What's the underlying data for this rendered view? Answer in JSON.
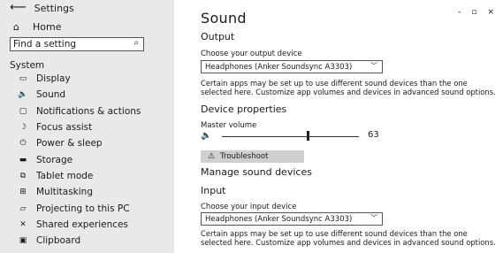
{
  "window": {
    "title": "Settings",
    "minimize": "-",
    "maximize": "▫",
    "close": "×"
  },
  "sidebar": {
    "home_label": "Home",
    "search_placeholder": "Find a setting",
    "group_label": "System",
    "items": [
      {
        "label": "Display",
        "icon": "monitor-icon",
        "glyph": "▭"
      },
      {
        "label": "Sound",
        "icon": "speaker-icon",
        "glyph": "🔈"
      },
      {
        "label": "Notifications & actions",
        "icon": "notifications-icon",
        "glyph": "▢"
      },
      {
        "label": "Focus assist",
        "icon": "moon-icon",
        "glyph": "☽"
      },
      {
        "label": "Power & sleep",
        "icon": "power-icon",
        "glyph": "⏻"
      },
      {
        "label": "Storage",
        "icon": "storage-icon",
        "glyph": "▬"
      },
      {
        "label": "Tablet mode",
        "icon": "tablet-icon",
        "glyph": "⧉"
      },
      {
        "label": "Multitasking",
        "icon": "multitasking-icon",
        "glyph": "⊞"
      },
      {
        "label": "Projecting to this PC",
        "icon": "projecting-icon",
        "glyph": "▱"
      },
      {
        "label": "Shared experiences",
        "icon": "shared-experiences-icon",
        "glyph": "✕"
      },
      {
        "label": "Clipboard",
        "icon": "clipboard-icon",
        "glyph": "▣"
      }
    ]
  },
  "main": {
    "title": "Sound",
    "output": {
      "heading": "Output",
      "device_label": "Choose your output device",
      "device_value": "Headphones (Anker Soundsync A3303)",
      "description": "Certain apps may be set up to use different sound devices than the one selected here. Customize app volumes and devices in advanced sound options.",
      "properties_heading": "Device properties",
      "volume_label": "Master volume",
      "volume_value": "63",
      "volume_level": 0.63,
      "troubleshoot_label": "Troubleshoot",
      "manage_label": "Manage sound devices"
    },
    "input": {
      "heading": "Input",
      "device_label": "Choose your input device",
      "device_value": "Headphones (Anker Soundsync A3303)",
      "description": "Certain apps may be set up to use different sound devices than the one selected here. Customize app volumes and devices in advanced sound options."
    }
  }
}
